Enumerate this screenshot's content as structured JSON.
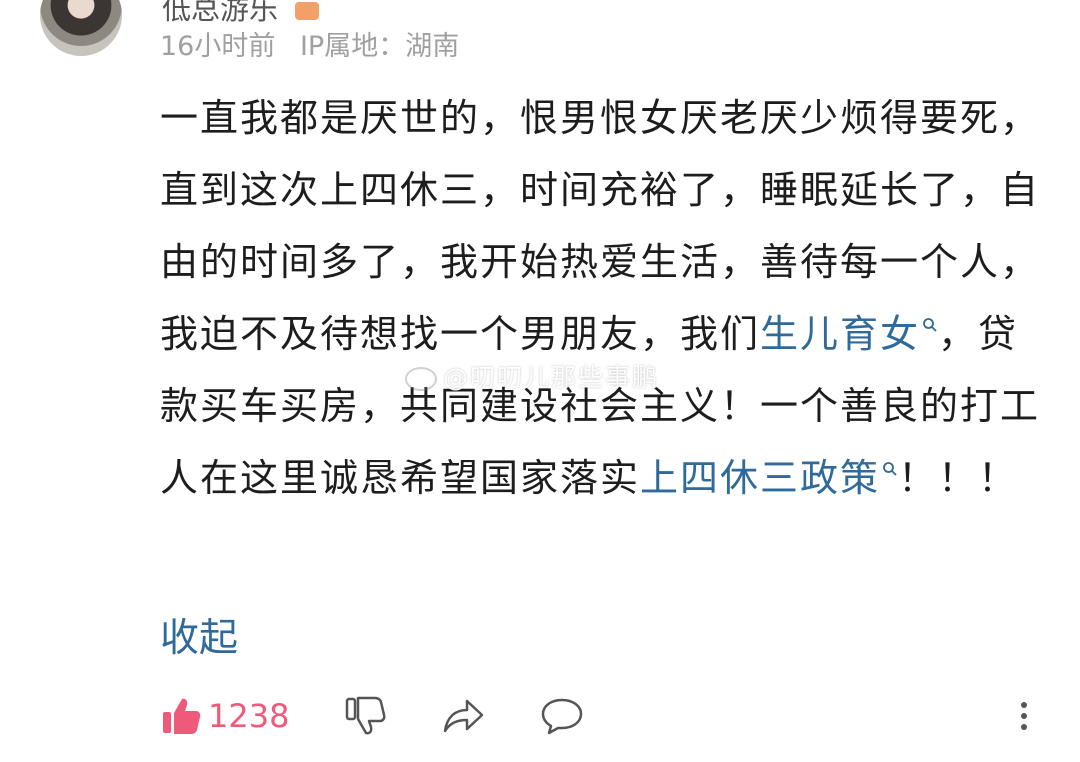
{
  "user": {
    "name": "低总游乐"
  },
  "meta": {
    "time": "16小时前",
    "ip_label": "IP属地：",
    "location": "湖南"
  },
  "content": {
    "line1": "一直我都是厌世的，恨男恨女厌老厌少烦得要死，直到这次上四休三，时间充裕了，睡眠延长了，自由的时间多了，我开始热爱生活，善待每一个人，我迫不及待想找一个男朋友，我们",
    "topic1": "生儿育女",
    "line2": "，贷款买车买房，共同建设社会主义！一个善良的打工人在这里诚恳希望国家落实",
    "topic2": "上四休三政策",
    "line3": "！！！"
  },
  "watermark": "@叨叨儿那些事鹏",
  "actions": {
    "collapse": "收起",
    "like_count": "1238"
  },
  "icons": {
    "like": "thumbs-up-icon",
    "dislike": "thumbs-down-icon",
    "share": "share-icon",
    "comment": "comment-icon",
    "more": "more-icon"
  },
  "colors": {
    "topic": "#2f6a9a",
    "like": "#f05a7a",
    "text": "#1d1d1d",
    "meta": "#a0a0a0"
  }
}
